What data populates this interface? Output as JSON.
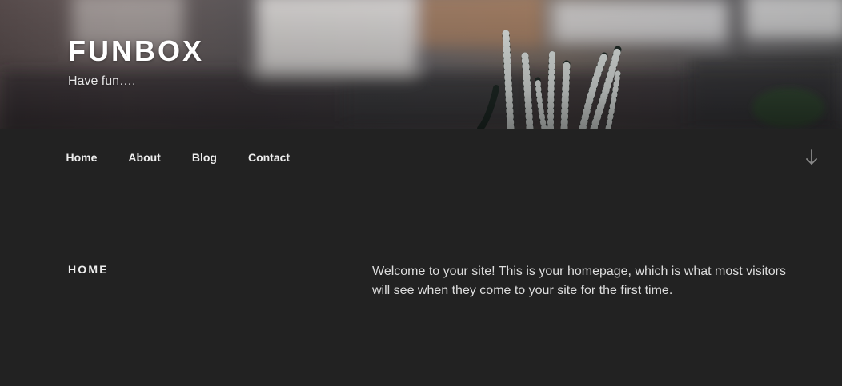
{
  "site": {
    "title": "FUNBOX",
    "tagline": "Have fun…."
  },
  "nav": {
    "items": [
      {
        "label": "Home"
      },
      {
        "label": "About"
      },
      {
        "label": "Blog"
      },
      {
        "label": "Contact"
      }
    ],
    "scroll_icon": "arrow-down-icon"
  },
  "page": {
    "title": "HOME",
    "body": "Welcome to your site! This is your homepage, which is what most visitors will see when they come to your site for the first time."
  },
  "colors": {
    "background": "#222222",
    "text": "#eeeeee"
  }
}
